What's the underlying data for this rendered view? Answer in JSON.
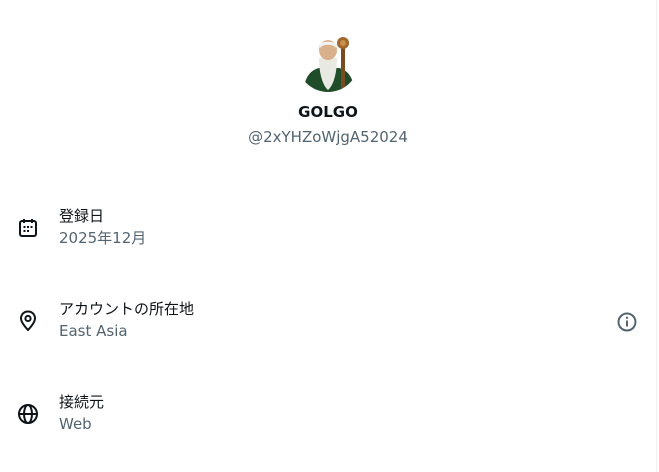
{
  "profile": {
    "display_name": "GOLGO",
    "handle": "@2xYHZoWjgA52024"
  },
  "rows": [
    {
      "title": "登録日",
      "value": "2025年12月",
      "icon": "calendar-icon"
    },
    {
      "title": "アカウントの所在地",
      "value": "East Asia",
      "icon": "location-pin-icon",
      "extra_icon": "info-icon"
    },
    {
      "title": "接続元",
      "value": "Web",
      "icon": "globe-icon"
    }
  ],
  "colors": {
    "primary_text": "#0f1419",
    "secondary_text": "#536471",
    "background": "#ffffff"
  }
}
